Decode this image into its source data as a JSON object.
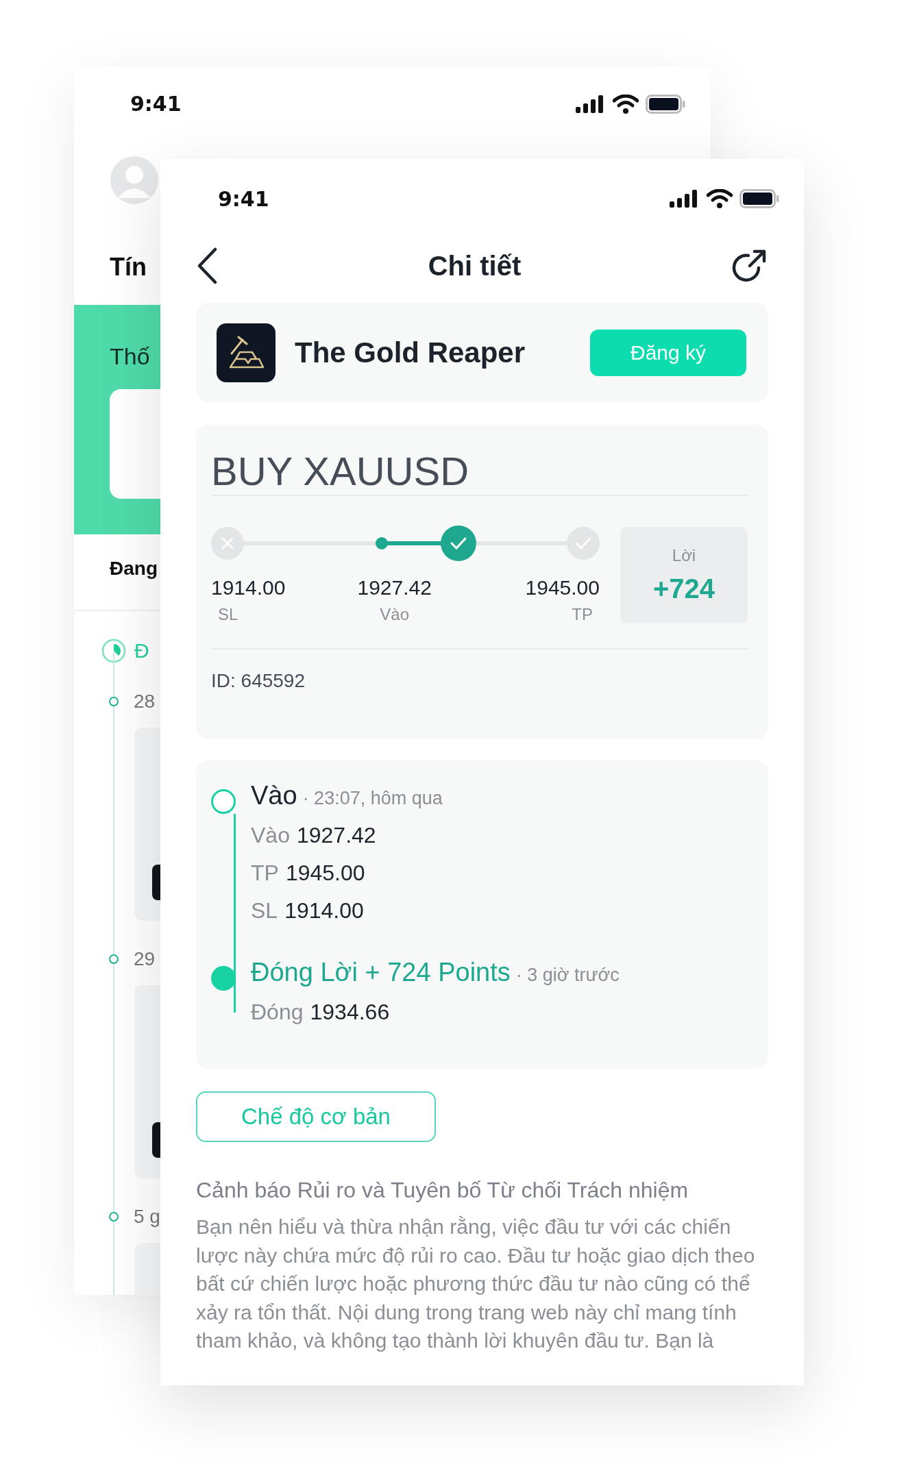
{
  "back_screen": {
    "status_time": "9:41",
    "title": "Tín",
    "banner_title": "Thố",
    "section_title": "Đang",
    "timeline_header": "Đ",
    "groups": [
      {
        "date": "28",
        "card": {
          "has_button": true
        }
      },
      {
        "date": "29",
        "card": {
          "has_button": true
        }
      },
      {
        "date": "5 g"
      }
    ]
  },
  "front_screen": {
    "status_time": "9:41",
    "title": "Chi tiết",
    "provider": {
      "name": "The Gold Reaper",
      "button": "Đăng ký"
    },
    "trade": {
      "title": "BUY XAUUSD",
      "points": [
        {
          "kind": "stop",
          "value": "1914.00",
          "label": "SL",
          "hit": false
        },
        {
          "kind": "entry",
          "value": "1927.42",
          "label": "Vào"
        },
        {
          "kind": "target",
          "value": "1945.00",
          "label": "TP",
          "hit": false
        }
      ],
      "progress": {
        "level": 0.65,
        "reached": true
      },
      "result": {
        "label": "Lời",
        "value": "+724"
      },
      "id": "ID: 645592"
    },
    "history": [
      {
        "kind": "open",
        "title": "Vào",
        "time": "· 23:07, hôm qua",
        "rows": [
          {
            "label": "Vào",
            "value": "1927.42"
          },
          {
            "label": "TP",
            "value": "1945.00"
          },
          {
            "label": "SL",
            "value": "1914.00"
          }
        ]
      },
      {
        "kind": "close",
        "title": "Đóng Lời + 724 Points",
        "time": "· 3 giờ trước",
        "rows": [
          {
            "label": "Đóng",
            "value": "1934.66"
          }
        ]
      }
    ],
    "mode_button": "Chế độ cơ bản",
    "disclaimer": {
      "title": "Cảnh báo Rủi ro và Tuyên bố Từ chối Trách nhiệm",
      "text": "Bạn nên hiểu và thừa nhận rằng, việc đầu tư với các chiến lược này chứa mức độ rủi ro cao. Đầu tư hoặc giao dịch theo bất cứ chiến lược hoặc phương thức đầu tư nào cũng có thể xảy ra tổn thất. Nội dung trong trang web này chỉ mang tính tham khảo, và không tạo thành lời khuyên đầu tư. Bạn là"
    }
  }
}
